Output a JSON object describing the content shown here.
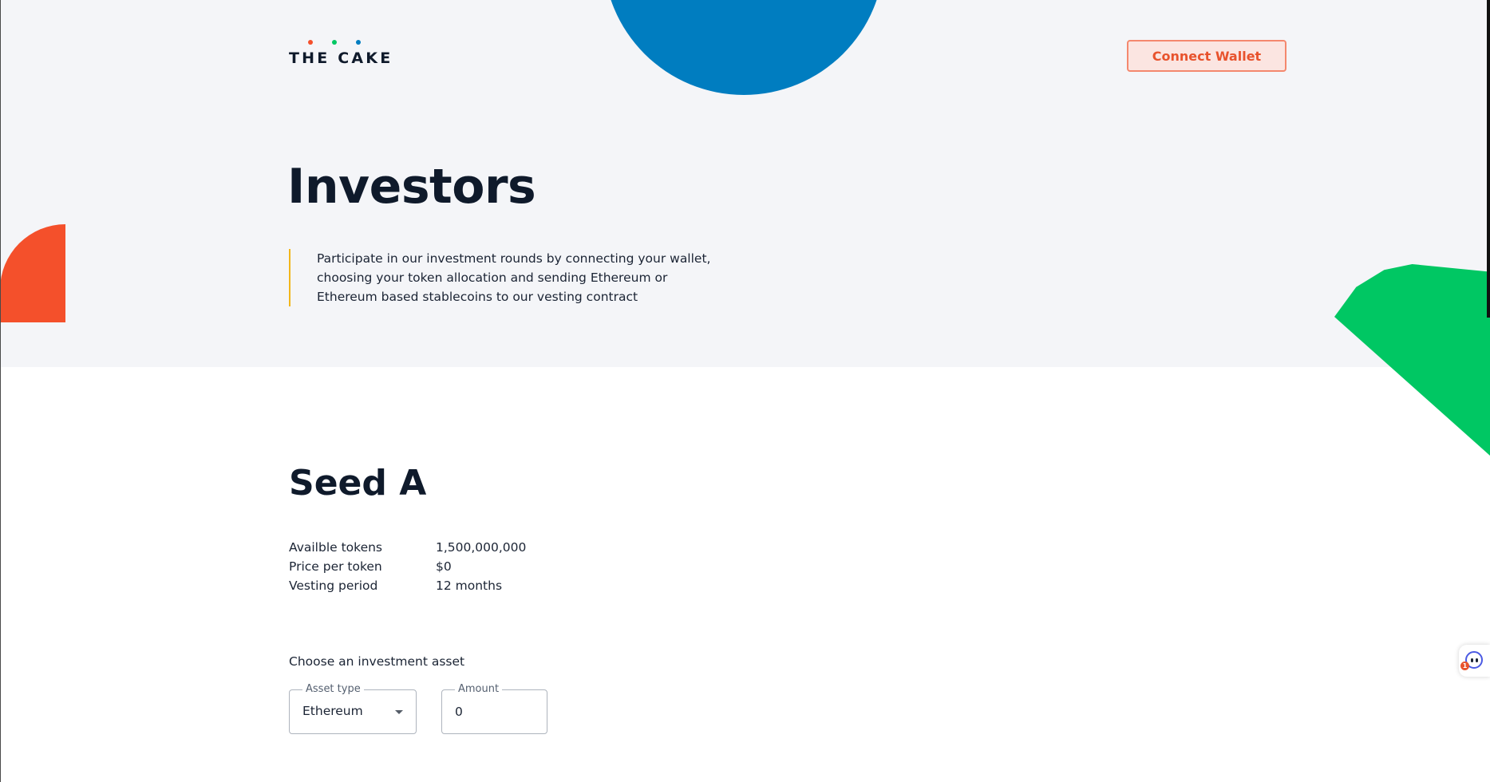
{
  "header": {
    "logo_text": "THE CAKE",
    "logo_dot_colors": [
      "#f4502b",
      "#00c763",
      "#007dc0"
    ],
    "connect_wallet_label": "Connect Wallet"
  },
  "hero": {
    "title": "Investors",
    "intro_lines": [
      "Participate in our investment rounds by connecting your wallet,",
      "choosing your token allocation and sending Ethereum or",
      "Ethereum based stablecoins to our vesting contract"
    ]
  },
  "round": {
    "title": "Seed A",
    "details": [
      {
        "label": "Availble tokens",
        "value": "1,500,000,000"
      },
      {
        "label": "Price per token",
        "value": "$0"
      },
      {
        "label": "Vesting period",
        "value": "12 months"
      }
    ]
  },
  "investment": {
    "choose_label": "Choose an investment asset",
    "asset_type_label": "Asset type",
    "asset_type_value": "Ethereum",
    "amount_label": "Amount",
    "amount_value": "0"
  },
  "chat_widget": {
    "icon": "chat-bot-icon",
    "badge_count": "1"
  },
  "colors": {
    "hero_background": "#f4f5f8",
    "blue_accent": "#007dc0",
    "orange_accent": "#f4502b",
    "green_accent": "#00c763",
    "quote_border": "#f2b61b",
    "button_background": "#fbe5e1",
    "button_text": "#e8532d",
    "heading_text": "#0f1a2b"
  }
}
